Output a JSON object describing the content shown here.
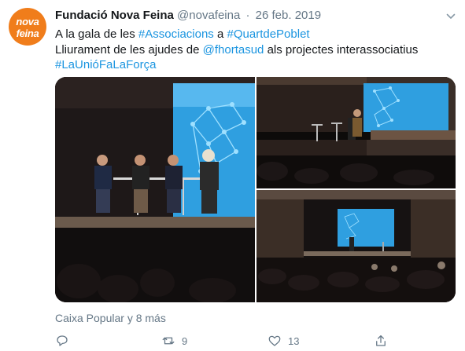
{
  "tweet": {
    "avatar_logo_top": "nova",
    "avatar_logo_bottom": "feina",
    "author_name": "Fundació Nova Feina",
    "handle": "@novafeina",
    "separator": "·",
    "date": "26 feb. 2019",
    "line1_prefix": "A la gala de les ",
    "line1_tag1": "#Associacions",
    "line1_mid": " a ",
    "line1_tag2": "#QuartdePoblet",
    "line2_prefix": "Lliurament de les ajudes de ",
    "line2_mention": "@fhortasud",
    "line2_suffix": " als projectes interassociatius",
    "line3_tag": "#LaUnióFaLaForça",
    "media_tagline": "Caixa Popular y 8 más",
    "retweet_count": "9",
    "like_count": "13"
  },
  "colors": {
    "link": "#1b95e0",
    "secondary_text": "#657786",
    "brand_orange": "#f07d1b",
    "screen_blue": "#2aa3e6"
  },
  "icons": [
    "chevron-down-icon",
    "reply-icon",
    "retweet-icon",
    "like-icon",
    "share-icon"
  ]
}
